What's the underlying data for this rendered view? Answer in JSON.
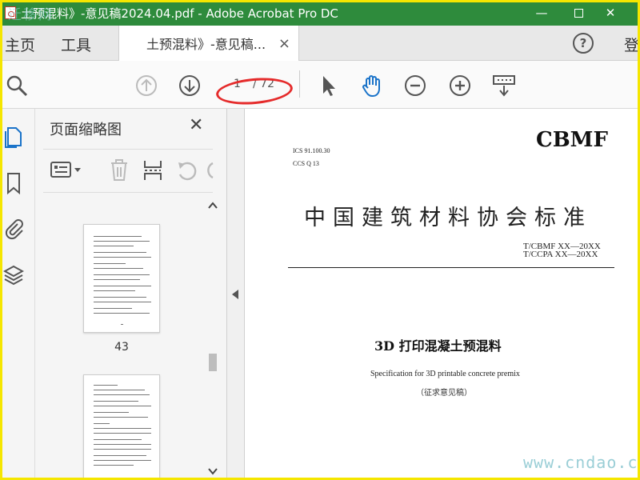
{
  "window": {
    "title": "土预混料》-意见稿2024.04.pdf - Adobe Acrobat Pro DC",
    "watermark_top": "迁移网",
    "minimize": "—",
    "close": "✕"
  },
  "menu": {
    "home": "主页",
    "tools": "工具",
    "doc_tab": "土预混料》-意见稿...",
    "doc_tab_close": "×",
    "help": "?",
    "login": "登"
  },
  "toolbar": {
    "current_page": "1",
    "total_pages": "/ 72",
    "highlight_color": "#e52b2b"
  },
  "thumbnails": {
    "title": "页面缩略图",
    "close": "✕",
    "labels": [
      "43"
    ]
  },
  "document": {
    "brand": "CBMF",
    "ics": "ICS 91.100.30",
    "ccs": "CCS Q 13",
    "org": "中国建筑材料协会标准",
    "std1": "T/CBMF XX—20XX",
    "std2": "T/CCPA XX—20XX",
    "title": "3D 打印混凝土预混料",
    "title_en": "Specification for 3D printable concrete premix",
    "draft": "（征求意见稿）",
    "watermark": "www.cndao.com"
  },
  "colors": {
    "titlebar": "#2e8b3c",
    "accent_blue": "#1a73c9",
    "frame": "#f5e600"
  }
}
